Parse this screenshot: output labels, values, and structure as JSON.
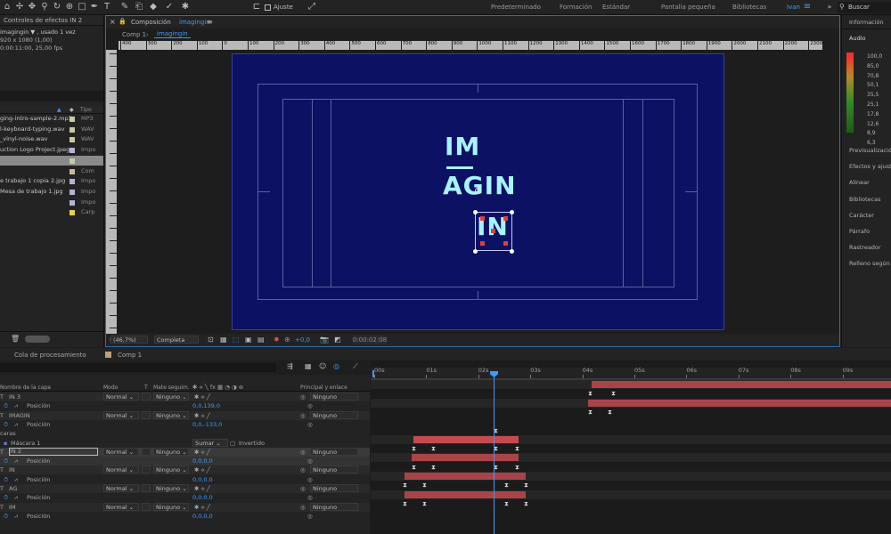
{
  "toolbar": {
    "snap_label": "Ajuste",
    "workspaces": [
      "Predeterminado",
      "Formación",
      "Estándar",
      "Pantalla pequeña",
      "Bibliotecas",
      "Ivan"
    ],
    "search_placeholder": "Buscar"
  },
  "effects_panel": {
    "tab": "Controles de efectos IN 2",
    "comp_name": "imagingin ▼ , usado 1 vez",
    "dims": "920 x 1080 (1,00)",
    "duration": "0:00:11:00, 25,00 fps"
  },
  "project": {
    "col_type": "Tipo",
    "items": [
      {
        "name": "ging-intro-sample-2.mp3",
        "type": "MP3",
        "color": "#c9c9a6"
      },
      {
        "name": "l-keyboard-typing.wav",
        "type": "WAV",
        "color": "#c9c9a6"
      },
      {
        "name": "_vinyl-noise.wav",
        "type": "WAV",
        "color": "#c9c9a6"
      },
      {
        "name": "uction Logo Project.jpeg",
        "type": "Impo",
        "color": "#b3b3d6"
      },
      {
        "name": "",
        "type": "Com",
        "color": "#c9c9a6"
      },
      {
        "name": "",
        "type": "Com",
        "color": "#c9b5a0"
      },
      {
        "name": "e trabajo 1 copia 2.jpg",
        "type": "Impo",
        "color": "#b3b3d6"
      },
      {
        "name": "Mesa de trabajo 1.jpg",
        "type": "Impo",
        "color": "#b3b3d6"
      },
      {
        "name": "",
        "type": "Impo",
        "color": "#b3b3d6"
      },
      {
        "name": "",
        "type": "Carp",
        "color": "#e6d14d"
      }
    ]
  },
  "composition": {
    "tab_prefix": "Composición",
    "tab_name": "imagingin",
    "breadcrumb": [
      "Comp 1",
      "imagingin"
    ],
    "ruler_labels": [
      "400",
      "300",
      "200",
      "100",
      "0",
      "100",
      "200",
      "300",
      "400",
      "500",
      "600",
      "700",
      "800",
      "900",
      "1000",
      "1100",
      "1200",
      "1300",
      "1400",
      "1500",
      "1600",
      "1700",
      "1800",
      "1900",
      "2000",
      "2100",
      "2200",
      "2300"
    ],
    "logo_lines": [
      "IM",
      "AGIN",
      "IN"
    ],
    "zoom": "(46,7%)",
    "quality": "Completa",
    "exposure": "+0,0",
    "timecode": "0:00:02:08",
    "canvas_color": "#0d1163",
    "logo_color": "#a9f2ff"
  },
  "right_panel": {
    "info": "Información",
    "audio": "Audio",
    "levels": [
      "100,0",
      "85,0",
      "70,8",
      "50,1",
      "35,5",
      "25,1",
      "17,8",
      "12,6",
      "8,9",
      "6,3"
    ],
    "sections": [
      "Previsualización",
      "Efectos y ajuste",
      "Alinear",
      "Bibliotecas",
      "Carácter",
      "Párrafo",
      "Rastreador",
      "Relleno según el"
    ]
  },
  "timeline": {
    "tabs": [
      "Cola de procesamiento",
      "Comp 1"
    ],
    "headers": {
      "layer_name": "Nombre de la capa",
      "mode": "Modo",
      "t": "T",
      "matte": "Mate seguim.",
      "parent": "Principal y enlace"
    },
    "time_ticks": [
      "00s",
      "01s",
      "02s",
      "03s",
      "04s",
      "05s",
      "06s",
      "07s",
      "08s",
      "09s"
    ],
    "rows": [
      {
        "kind": "layer",
        "name": "IN 3",
        "mode": "Normal",
        "matte": "Ninguno",
        "parent": "Ninguno"
      },
      {
        "kind": "prop",
        "name": "Posición",
        "value": "0,0,139,0"
      },
      {
        "kind": "layer",
        "name": "IMAGIN",
        "mode": "Normal",
        "matte": "Ninguno",
        "parent": "Ninguno"
      },
      {
        "kind": "prop",
        "name": "Posición",
        "value": "0,0,-133,0"
      },
      {
        "kind": "group",
        "name": "caras"
      },
      {
        "kind": "mask",
        "name": "Máscara 1",
        "mode": "Sumar",
        "inverted": "Invertido"
      },
      {
        "kind": "layer",
        "name": "IN 2",
        "mode": "Normal",
        "matte": "Ninguno",
        "parent": "Ninguno",
        "selected": true
      },
      {
        "kind": "prop",
        "name": "Posición",
        "value": "0,0,0,0"
      },
      {
        "kind": "layer",
        "name": "IN",
        "mode": "Normal",
        "matte": "Ninguno",
        "parent": "Ninguno"
      },
      {
        "kind": "prop",
        "name": "Posición",
        "value": "0,0,0,0"
      },
      {
        "kind": "layer",
        "name": "AG",
        "mode": "Normal",
        "matte": "Ninguno",
        "parent": "Ninguno"
      },
      {
        "kind": "prop",
        "name": "Posición",
        "value": "0,0,0,0"
      },
      {
        "kind": "layer",
        "name": "IM",
        "mode": "Normal",
        "matte": "Ninguno",
        "parent": "Ninguno"
      },
      {
        "kind": "prop",
        "name": "Posición",
        "value": "0,0,0,0"
      }
    ]
  }
}
